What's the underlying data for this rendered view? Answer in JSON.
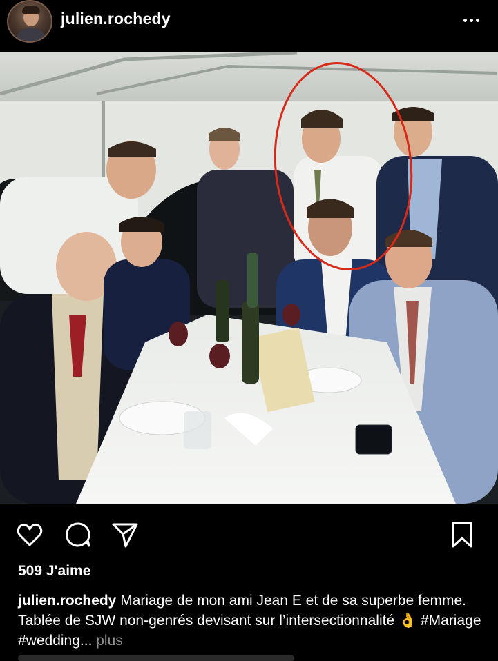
{
  "header": {
    "username": "julien.rochedy"
  },
  "post": {
    "likes": "509 J'aime",
    "caption": {
      "username": "julien.rochedy",
      "text": " Mariage de mon ami Jean E et de sa superbe femme. Tablée de SJW non-genrés devisant sur l’intersectionnalité 👌 #Mariage #wedding... ",
      "more": "plus"
    }
  },
  "icons": {
    "like": "heart-icon",
    "comment": "comment-icon",
    "share": "send-icon",
    "save": "bookmark-icon",
    "options": "more-options-icon"
  },
  "colors": {
    "background": "#000000",
    "text": "#ffffff",
    "muted": "#8e8e8e",
    "annotation_circle": "#d62a1a"
  }
}
